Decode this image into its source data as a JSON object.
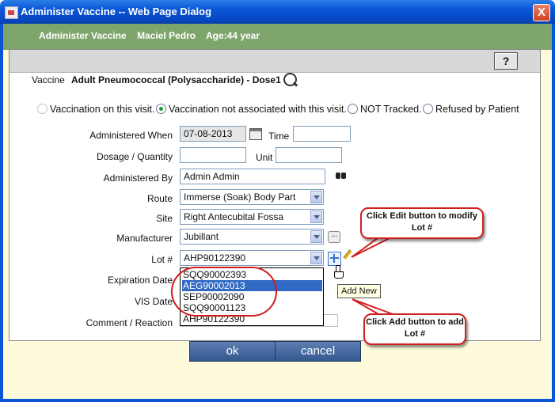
{
  "window": {
    "title": "Administer Vaccine -- Web Page Dialog",
    "close_label": "X"
  },
  "header": {
    "title": "Administer Vaccine",
    "patient": "Maciel Pedro",
    "age": "Age:44 year"
  },
  "help_label": "?",
  "vaccine": {
    "label": "Vaccine",
    "value": "Adult Pneumococcal (Polysaccharide) - Dose1"
  },
  "vaccination_options": [
    {
      "label": "Vaccination on this visit.",
      "checked": false
    },
    {
      "label": "Vaccination not associated with this visit.",
      "checked": true
    },
    {
      "label": "NOT Tracked.",
      "checked": false
    },
    {
      "label": "Refused by Patient",
      "checked": false
    }
  ],
  "fields": {
    "administered_when": {
      "label": "Administered When",
      "value": "07-08-2013"
    },
    "time": {
      "label": "Time",
      "value": ""
    },
    "dosage": {
      "label": "Dosage / Quantity",
      "value": ""
    },
    "unit": {
      "label": "Unit",
      "value": ""
    },
    "administered_by": {
      "label": "Administered By",
      "value": "Admin Admin"
    },
    "route": {
      "label": "Route",
      "value": "Immerse (Soak) Body Part"
    },
    "site": {
      "label": "Site",
      "value": "Right Antecubital Fossa"
    },
    "manufacturer": {
      "label": "Manufacturer",
      "value": "Jubillant"
    },
    "lot": {
      "label": "Lot #",
      "value": "AHP90122390"
    },
    "expiration_date": {
      "label": "Expiration Date"
    },
    "vis_date": {
      "label": "VIS Date"
    },
    "comment": {
      "label": "Comment / Reaction"
    }
  },
  "lot_options": [
    "SQQ90002393",
    "AEG90002013",
    "SEP90002090",
    "SQQ90001123",
    "AHP90122390"
  ],
  "lot_selected_index": 1,
  "more_label": "...",
  "tooltip": "Add New",
  "callouts": {
    "edit": "Click Edit button to modify Lot #",
    "add": "Click Add button to add Lot #"
  },
  "buttons": {
    "ok": "ok",
    "cancel": "cancel"
  },
  "colors": {
    "title_bar": "#0a55d6",
    "header_band": "#7ea56b",
    "button": "#34588f",
    "highlight": "#d01a1a",
    "selected_option": "#316ac5"
  }
}
